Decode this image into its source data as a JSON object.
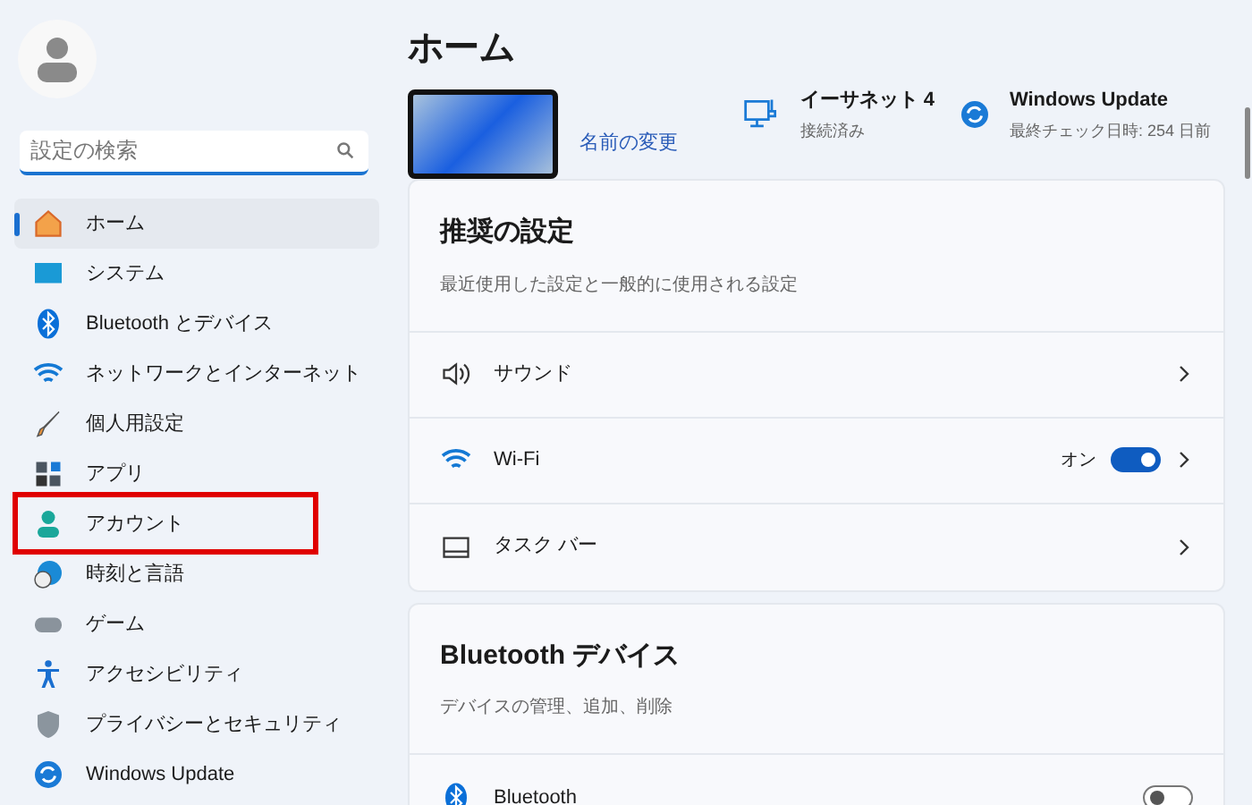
{
  "sidebar": {
    "search": {
      "placeholder": "設定の検索"
    },
    "items": [
      {
        "label": "ホーム",
        "kind": "home",
        "selected": true,
        "highlighted": false
      },
      {
        "label": "システム",
        "kind": "system",
        "selected": false,
        "highlighted": false
      },
      {
        "label": "Bluetooth とデバイス",
        "kind": "bluetooth",
        "selected": false,
        "highlighted": false
      },
      {
        "label": "ネットワークとインターネット",
        "kind": "wifi",
        "selected": false,
        "highlighted": false
      },
      {
        "label": "個人用設定",
        "kind": "brush",
        "selected": false,
        "highlighted": false
      },
      {
        "label": "アプリ",
        "kind": "apps",
        "selected": false,
        "highlighted": false
      },
      {
        "label": "アカウント",
        "kind": "account",
        "selected": false,
        "highlighted": true
      },
      {
        "label": "時刻と言語",
        "kind": "time",
        "selected": false,
        "highlighted": false
      },
      {
        "label": "ゲーム",
        "kind": "game",
        "selected": false,
        "highlighted": false
      },
      {
        "label": "アクセシビリティ",
        "kind": "access",
        "selected": false,
        "highlighted": false
      },
      {
        "label": "プライバシーとセキュリティ",
        "kind": "shield",
        "selected": false,
        "highlighted": false
      },
      {
        "label": "Windows Update",
        "kind": "update",
        "selected": false,
        "highlighted": false
      }
    ]
  },
  "page": {
    "title": "ホーム"
  },
  "device": {
    "rename_link": "名前の変更"
  },
  "status": [
    {
      "kind": "network",
      "title": "イーサネット 4",
      "subtitle": "接続済み"
    },
    {
      "kind": "update",
      "title": "Windows Update",
      "subtitle": "最終チェック日時: 254 日前"
    }
  ],
  "cards": [
    {
      "title": "推奨の設定",
      "subtitle": "最近使用した設定と一般的に使用される設定",
      "rows": [
        {
          "label": "サウンド",
          "kind": "link"
        },
        {
          "label": "Wi-Fi",
          "kind": "toggle",
          "state_text": "オン",
          "on": true
        },
        {
          "label": "タスク バー",
          "kind": "link"
        }
      ]
    },
    {
      "title": "Bluetooth デバイス",
      "subtitle": "デバイスの管理、追加、削除",
      "rows": [
        {
          "label": "Bluetooth",
          "kind": "toggle",
          "on": false
        }
      ]
    }
  ]
}
